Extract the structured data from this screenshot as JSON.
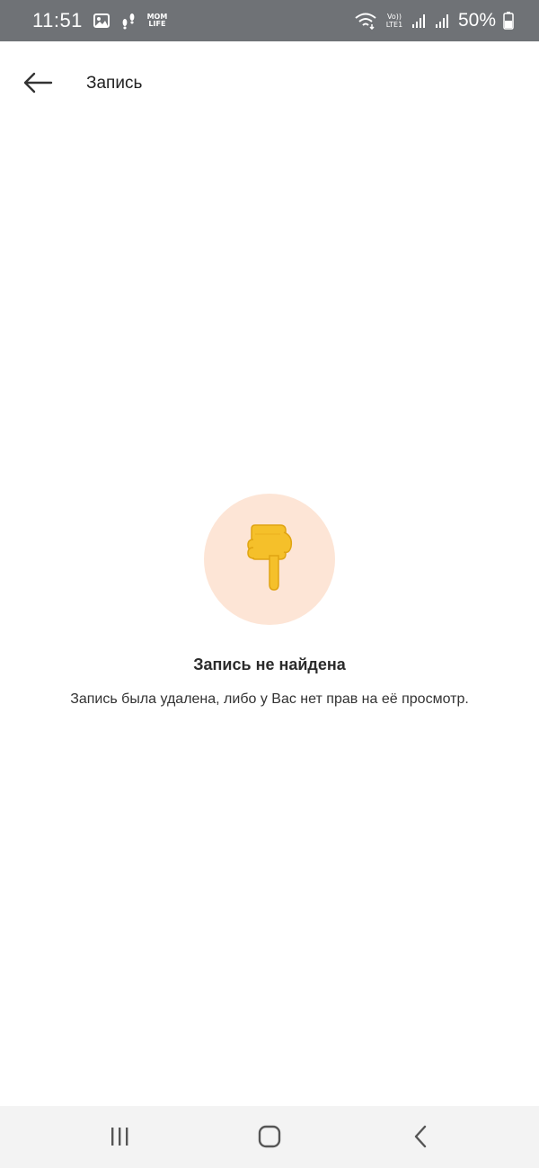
{
  "status_bar": {
    "time": "11:51",
    "battery": "50%",
    "app_icon_label": "MOM LIFE",
    "network_label": "Vo)) LTE1",
    "icons": [
      "image-icon",
      "footprints-icon",
      "momlife-app-icon",
      "wifi-icon",
      "volte-icon",
      "signal-icon",
      "signal-icon-2",
      "battery-icon"
    ]
  },
  "header": {
    "title": "Запись",
    "back_icon": "arrow-left-icon"
  },
  "empty_state": {
    "icon": "pointing-down-hand-icon",
    "title": "Запись не найдена",
    "description": "Запись была удалена, либо у Вас нет прав на её просмотр."
  },
  "nav_bar": {
    "icons": [
      "recent-apps-icon",
      "home-icon",
      "back-icon"
    ]
  },
  "colors": {
    "status_bar_bg": "#6f7276",
    "illustration_bg": "#fde5d6",
    "nav_bar_bg": "#f3f3f3",
    "emoji_yellow": "#f5c02a"
  }
}
